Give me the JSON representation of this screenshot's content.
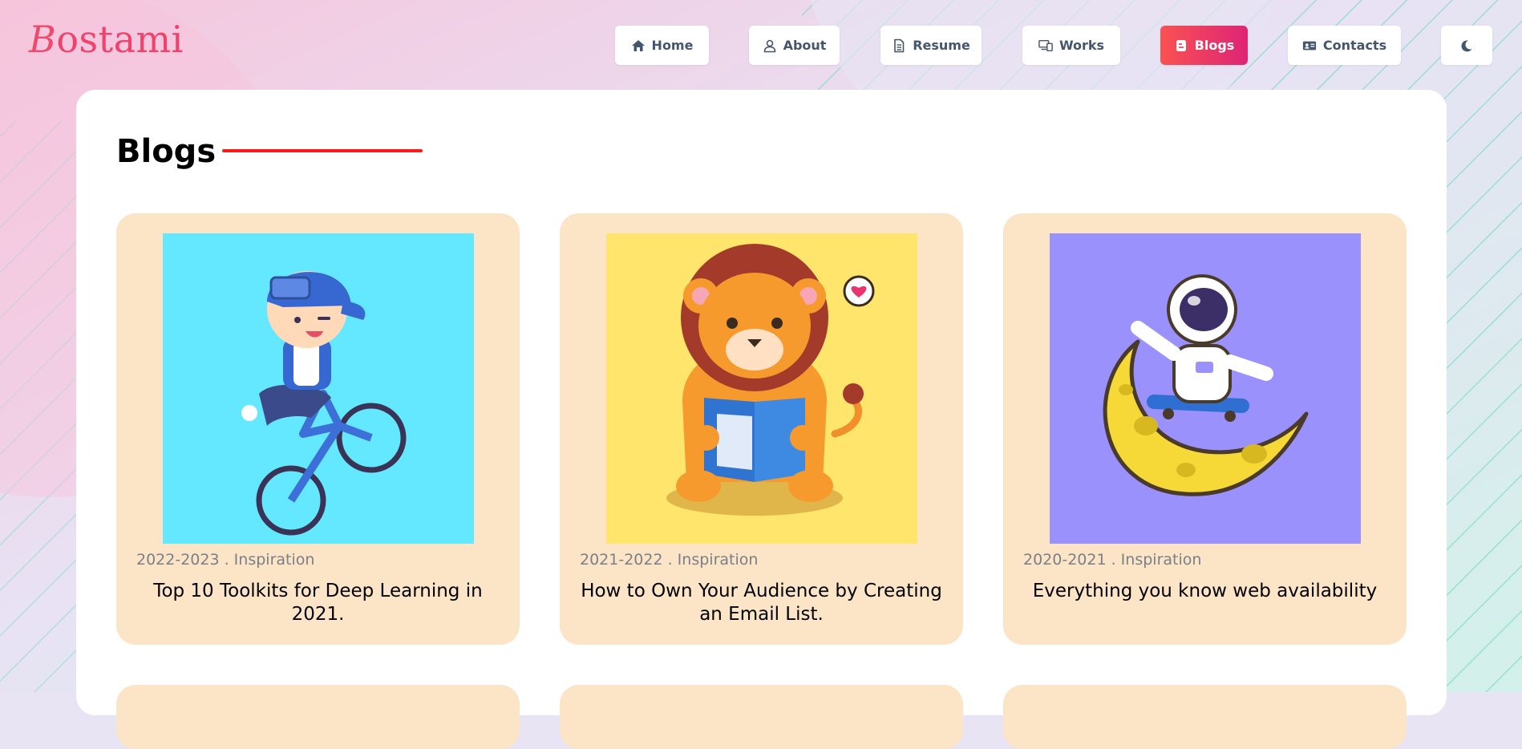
{
  "logo": {
    "first_letter": "B",
    "rest": "ostami"
  },
  "nav": [
    {
      "label": "Home",
      "icon": "home-icon"
    },
    {
      "label": "About",
      "icon": "user-icon"
    },
    {
      "label": "Resume",
      "icon": "file-icon"
    },
    {
      "label": "Works",
      "icon": "devices-icon"
    },
    {
      "label": "Blogs",
      "icon": "blog-icon",
      "active": true
    },
    {
      "label": "Contacts",
      "icon": "contact-card-icon"
    }
  ],
  "theme_toggle": {
    "icon": "moon-icon"
  },
  "page": {
    "title": "Blogs"
  },
  "blogs": [
    {
      "meta": "2022-2023 . Inspiration",
      "title": "Top 10 Toolkits for Deep Learning in 2021.",
      "image": "boy-on-bike-illustration",
      "bg": "#64e8ff"
    },
    {
      "meta": "2021-2022 . Inspiration",
      "title": "How to Own Your Audience by Creating an Email List.",
      "image": "lion-reading-illustration",
      "bg": "#ffe56b"
    },
    {
      "meta": "2020-2021 . Inspiration",
      "title": "Everything you know web availability",
      "image": "astronaut-on-moon-illustration",
      "bg": "#9b91fc"
    }
  ],
  "colors": {
    "accent": "#f0426b",
    "card_bg": "#fce4c6",
    "title_line": "#fa1a1a"
  }
}
